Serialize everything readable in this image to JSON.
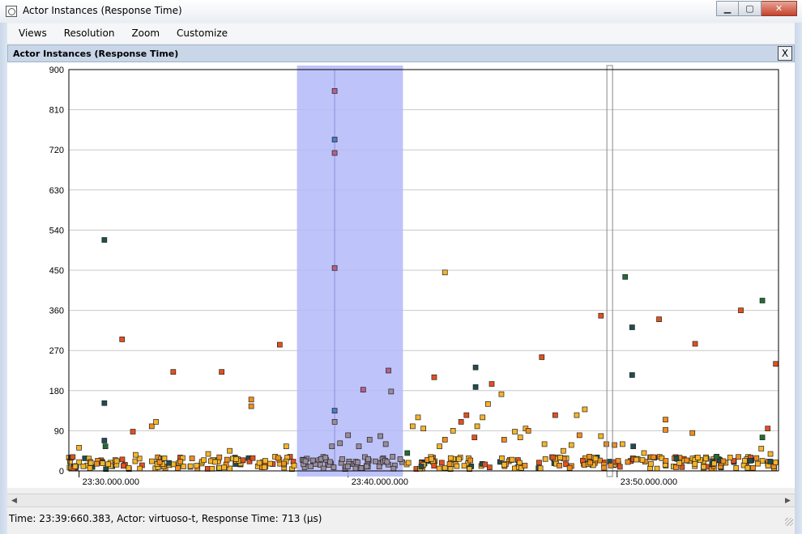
{
  "window": {
    "title": "Actor Instances (Response Time)",
    "minimize_glyph": "▁",
    "maximize_glyph": "▢",
    "close_glyph": "✕"
  },
  "menu": [
    "Views",
    "Resolution",
    "Zoom",
    "Customize"
  ],
  "panel": {
    "title": "Actor Instances (Response Time)",
    "close_glyph": "X"
  },
  "status": {
    "text": "Time: 23:39:660.383, Actor: virtuoso-t, Response Time: 713 (µs)"
  },
  "scrollbar": {
    "left_arrow": "◀",
    "right_arrow": "▶"
  },
  "colors": {
    "selection": "#b3b8f8",
    "grid": "#c8c8c8",
    "series": [
      "#f6b526",
      "#f28e1c",
      "#e5501e",
      "#1f4e4f",
      "#1f6e35",
      "#4d7bc4",
      "#b5618c",
      "#9a8c9c"
    ]
  },
  "chart_data": {
    "type": "scatter",
    "xlabel": "",
    "ylabel": "",
    "ylim": [
      0,
      900
    ],
    "yticks": [
      0,
      90,
      180,
      270,
      360,
      450,
      540,
      630,
      720,
      810,
      900
    ],
    "xlim": [
      1,
      1320
    ],
    "xticks": [
      {
        "value": 20,
        "label": "23:30.000.000"
      },
      {
        "value": 520,
        "label": "23:40.000.000"
      },
      {
        "value": 1020,
        "label": "23:50.000.000"
      }
    ],
    "grid": true,
    "selection_range": [
      425,
      622
    ],
    "cursor_x": 495,
    "marker_x": 1001,
    "points": [
      {
        "x": 67,
        "y": 518,
        "c": 3
      },
      {
        "x": 67,
        "y": 152,
        "c": 3
      },
      {
        "x": 67,
        "y": 68,
        "c": 3
      },
      {
        "x": 69,
        "y": 55,
        "c": 4
      },
      {
        "x": 20,
        "y": 52,
        "c": 0
      },
      {
        "x": 100,
        "y": 295,
        "c": 2
      },
      {
        "x": 120,
        "y": 88,
        "c": 2
      },
      {
        "x": 155,
        "y": 100,
        "c": 1
      },
      {
        "x": 163,
        "y": 110,
        "c": 0
      },
      {
        "x": 195,
        "y": 222,
        "c": 2
      },
      {
        "x": 285,
        "y": 222,
        "c": 2
      },
      {
        "x": 340,
        "y": 160,
        "c": 1
      },
      {
        "x": 340,
        "y": 145,
        "c": 1
      },
      {
        "x": 393,
        "y": 283,
        "c": 2
      },
      {
        "x": 405,
        "y": 55,
        "c": 0
      },
      {
        "x": 495,
        "y": 852,
        "c": 6
      },
      {
        "x": 495,
        "y": 743,
        "c": 5
      },
      {
        "x": 495,
        "y": 713,
        "c": 6
      },
      {
        "x": 495,
        "y": 455,
        "c": 6
      },
      {
        "x": 495,
        "y": 135,
        "c": 5
      },
      {
        "x": 495,
        "y": 110,
        "c": 7
      },
      {
        "x": 548,
        "y": 182,
        "c": 6
      },
      {
        "x": 595,
        "y": 225,
        "c": 6
      },
      {
        "x": 600,
        "y": 178,
        "c": 7
      },
      {
        "x": 700,
        "y": 445,
        "c": 0
      },
      {
        "x": 680,
        "y": 210,
        "c": 2
      },
      {
        "x": 757,
        "y": 232,
        "c": 3
      },
      {
        "x": 757,
        "y": 188,
        "c": 3
      },
      {
        "x": 787,
        "y": 195,
        "c": 2
      },
      {
        "x": 805,
        "y": 172,
        "c": 0
      },
      {
        "x": 780,
        "y": 150,
        "c": 0
      },
      {
        "x": 740,
        "y": 125,
        "c": 2
      },
      {
        "x": 770,
        "y": 120,
        "c": 0
      },
      {
        "x": 880,
        "y": 255,
        "c": 2
      },
      {
        "x": 905,
        "y": 125,
        "c": 2
      },
      {
        "x": 945,
        "y": 125,
        "c": 0
      },
      {
        "x": 960,
        "y": 138,
        "c": 0
      },
      {
        "x": 990,
        "y": 348,
        "c": 2
      },
      {
        "x": 1035,
        "y": 435,
        "c": 4
      },
      {
        "x": 1048,
        "y": 322,
        "c": 3
      },
      {
        "x": 1048,
        "y": 215,
        "c": 3
      },
      {
        "x": 1098,
        "y": 340,
        "c": 2
      },
      {
        "x": 1110,
        "y": 115,
        "c": 1
      },
      {
        "x": 1110,
        "y": 92,
        "c": 1
      },
      {
        "x": 1165,
        "y": 285,
        "c": 2
      },
      {
        "x": 1160,
        "y": 85,
        "c": 1
      },
      {
        "x": 1250,
        "y": 360,
        "c": 2
      },
      {
        "x": 1290,
        "y": 382,
        "c": 4
      },
      {
        "x": 1290,
        "y": 75,
        "c": 4
      },
      {
        "x": 1300,
        "y": 95,
        "c": 2
      },
      {
        "x": 1315,
        "y": 240,
        "c": 2
      },
      {
        "x": 1288,
        "y": 50,
        "c": 0
      },
      {
        "x": 1305,
        "y": 38,
        "c": 0
      },
      {
        "x": 1030,
        "y": 60,
        "c": 0
      },
      {
        "x": 1050,
        "y": 55,
        "c": 3
      },
      {
        "x": 1015,
        "y": 58,
        "c": 1
      },
      {
        "x": 990,
        "y": 78,
        "c": 0
      },
      {
        "x": 1000,
        "y": 60,
        "c": 1
      },
      {
        "x": 850,
        "y": 95,
        "c": 0
      },
      {
        "x": 855,
        "y": 90,
        "c": 1
      },
      {
        "x": 840,
        "y": 75,
        "c": 0
      },
      {
        "x": 830,
        "y": 88,
        "c": 0
      },
      {
        "x": 810,
        "y": 70,
        "c": 1
      },
      {
        "x": 760,
        "y": 100,
        "c": 0
      },
      {
        "x": 755,
        "y": 75,
        "c": 2
      },
      {
        "x": 730,
        "y": 110,
        "c": 2
      },
      {
        "x": 715,
        "y": 90,
        "c": 0
      },
      {
        "x": 700,
        "y": 70,
        "c": 1
      },
      {
        "x": 690,
        "y": 55,
        "c": 0
      },
      {
        "x": 660,
        "y": 95,
        "c": 0
      },
      {
        "x": 650,
        "y": 120,
        "c": 0
      },
      {
        "x": 640,
        "y": 100,
        "c": 0
      },
      {
        "x": 630,
        "y": 40,
        "c": 4
      },
      {
        "x": 590,
        "y": 60,
        "c": 7
      },
      {
        "x": 580,
        "y": 78,
        "c": 7
      },
      {
        "x": 560,
        "y": 70,
        "c": 7
      },
      {
        "x": 540,
        "y": 55,
        "c": 7
      },
      {
        "x": 520,
        "y": 80,
        "c": 7
      },
      {
        "x": 505,
        "y": 62,
        "c": 7
      },
      {
        "x": 490,
        "y": 55,
        "c": 7
      },
      {
        "x": 478,
        "y": 30,
        "c": 7
      },
      {
        "x": 885,
        "y": 60,
        "c": 0
      },
      {
        "x": 920,
        "y": 45,
        "c": 0
      },
      {
        "x": 935,
        "y": 58,
        "c": 0
      },
      {
        "x": 950,
        "y": 80,
        "c": 1
      },
      {
        "x": 1070,
        "y": 40,
        "c": 0
      },
      {
        "x": 1230,
        "y": 30,
        "c": 0
      },
      {
        "x": 1205,
        "y": 32,
        "c": 4
      },
      {
        "x": 1170,
        "y": 30,
        "c": 0
      },
      {
        "x": 1130,
        "y": 28,
        "c": 3
      },
      {
        "x": 300,
        "y": 45,
        "c": 0
      },
      {
        "x": 260,
        "y": 38,
        "c": 0
      },
      {
        "x": 230,
        "y": 28,
        "c": 1
      },
      {
        "x": 125,
        "y": 36,
        "c": 0
      },
      {
        "x": 90,
        "y": 22,
        "c": 0
      }
    ],
    "baseline_band": {
      "y_min": 4,
      "y_max": 32,
      "count": 380
    }
  }
}
